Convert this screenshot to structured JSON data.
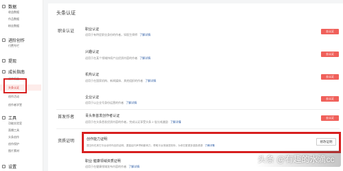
{
  "sidebar": {
    "groups": [
      {
        "label": "数据",
        "items": [
          "收益数据",
          "作品数据",
          "粉丝数据"
        ]
      },
      {
        "label": "进阶创作",
        "items": [
          "付费专栏"
        ]
      },
      {
        "label": "提现",
        "items": []
      },
      {
        "label": "成长指南",
        "items": [
          "创作权益",
          "头条认证",
          "创作活动",
          "创作者学堂"
        ]
      },
      {
        "label": "工具",
        "items": [
          "功能实验室",
          "直播工具",
          "头条创作",
          "创作保护",
          "图片素材"
        ]
      },
      {
        "label": "设置",
        "items": []
      }
    ],
    "active_item": "头条认证"
  },
  "main": {
    "title": "头条认证",
    "sections": [
      {
        "label": "职业认证",
        "certs": [
          {
            "name": "职业认证",
            "desc": "适用于有特定职业身份的作者，如医生律师",
            "link": "了解详情",
            "button": "去认证"
          },
          {
            "name": "兴趣认证",
            "desc": "适用于在某个领域持续产出优质内容的作者",
            "link": "了解详情",
            "button": "去认证"
          },
          {
            "name": "机构认证",
            "desc": "适用于在国家机构、新闻媒体、其他组织的作者",
            "link": "了解详情",
            "button": "去认证"
          },
          {
            "name": "企业认证",
            "desc": "适用于以企业号身份运营的作者",
            "link": "了解详情",
            "button": "去认证"
          }
        ]
      },
      {
        "label": "首发作者",
        "certs": [
          {
            "name": "青头条首发创作者认证",
            "desc": "适用于在头条首发优质内容的作者，完成认证享受头条 2 倍分成激励",
            "link": "了解详情",
            "button": "去认证"
          }
        ]
      },
      {
        "label": "资质证明",
        "certs": [
          {
            "name": "创作能力证明",
            "desc": "提交你在其它平台创作作品的证明，提高站内声誉和影响力，帮助平台快速发现你，为你匹配更多激励资源",
            "link": "了解详情",
            "button": "修改证明"
          },
          {
            "name": "职业·健康领域资质证明",
            "desc": "适用于在健康领域发布内容的作者",
            "link": "了解详情",
            "button": ""
          }
        ]
      }
    ]
  },
  "watermark": {
    "text": "头条 @有趣的水滴cc"
  }
}
